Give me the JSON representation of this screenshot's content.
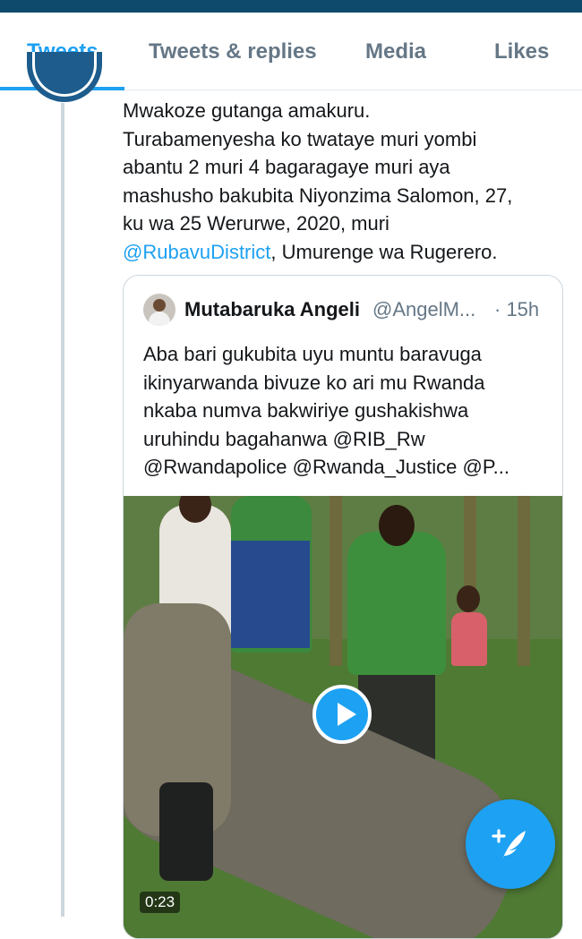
{
  "colors": {
    "accent": "#1da1f2",
    "text": "#14171a",
    "muted": "#657786",
    "status_bar": "#0d4a6b"
  },
  "tabs": [
    {
      "label": "Tweets",
      "active": true
    },
    {
      "label": "Tweets & replies",
      "active": false
    },
    {
      "label": "Media",
      "active": false
    },
    {
      "label": "Likes",
      "active": false
    }
  ],
  "tweet": {
    "text_lines": [
      "Mwakoze gutanga amakuru.",
      "Turabamenyesha ko twataye muri yombi",
      "abantu 2 muri 4 bagaragaye muri aya",
      "mashusho bakubita Niyonzima Salomon, 27,",
      "ku wa 25 Werurwe, 2020, muri"
    ],
    "mention": "@RubavuDistrict",
    "text_after_mention": ", Umurenge wa Rugerero."
  },
  "quoted_tweet": {
    "author_name": "Mutabaruka Angeli",
    "handle": "@AngelM...",
    "time": "· 15h",
    "text_lines": [
      "Aba bari gukubita uyu muntu baravuga",
      "ikinyarwanda bivuze ko ari mu Rwanda",
      "nkaba numva bakwiriye gushakishwa",
      "uruhindu bagahanwa @RIB_Rw",
      "@Rwandapolice @Rwanda_Justice @P..."
    ],
    "video_duration": "0:23",
    "play_icon": "play-icon"
  },
  "fab": {
    "icon": "compose-tweet-icon"
  }
}
